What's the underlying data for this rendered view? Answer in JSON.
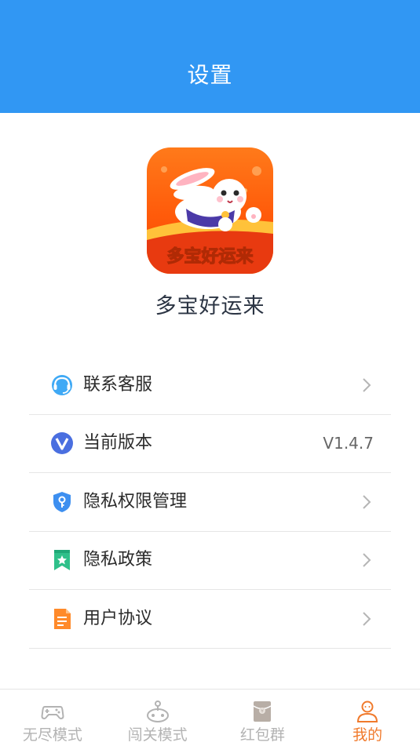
{
  "header": {
    "title": "设置"
  },
  "app": {
    "name": "多宝好运来",
    "logo_text": "多宝好运来"
  },
  "menu": [
    {
      "icon": "headset-icon",
      "label": "联系客服",
      "value": null
    },
    {
      "icon": "version-v-icon",
      "label": "当前版本",
      "value": "V1.4.7"
    },
    {
      "icon": "shield-key-icon",
      "label": "隐私权限管理",
      "value": null
    },
    {
      "icon": "bookmark-star-icon",
      "label": "隐私政策",
      "value": null
    },
    {
      "icon": "document-icon",
      "label": "用户协议",
      "value": null
    }
  ],
  "tabbar": [
    {
      "icon": "gamepad-icon",
      "label": "无尽模式",
      "active": false
    },
    {
      "icon": "joystick-icon",
      "label": "闯关模式",
      "active": false
    },
    {
      "icon": "red-envelope-icon",
      "label": "红包群",
      "active": false
    },
    {
      "icon": "user-icon",
      "label": "我的",
      "active": true
    }
  ],
  "colors": {
    "header": "#3197f3",
    "active_tab": "#f07a2c",
    "inactive_tab": "#b3b3b3"
  }
}
